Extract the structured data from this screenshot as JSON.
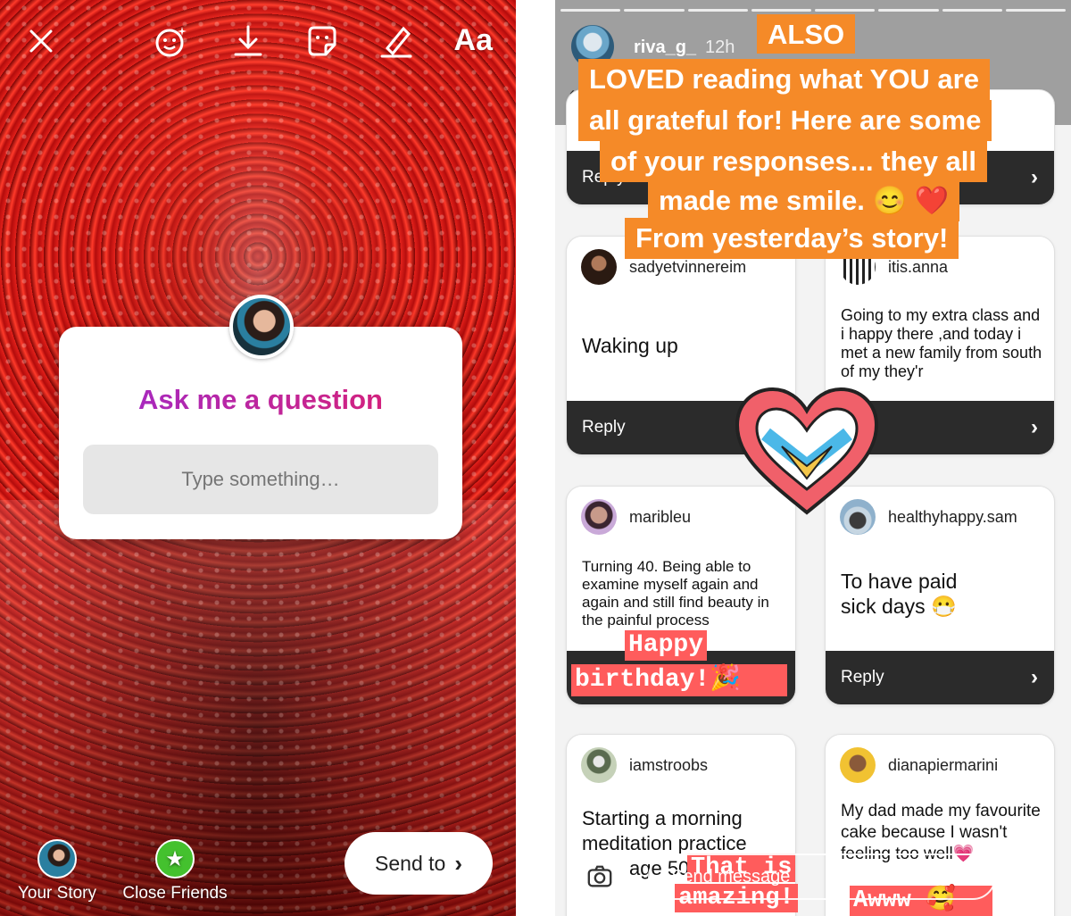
{
  "left": {
    "toolbar": {
      "close_icon": "close-icon",
      "face_effect_icon": "face-effects-icon",
      "download_icon": "download-icon",
      "sticker_icon": "sticker-icon",
      "draw_icon": "pen-icon",
      "text_label": "Aa"
    },
    "question_sticker": {
      "title": "Ask me a question",
      "placeholder": "Type something…"
    },
    "share": {
      "your_story": "Your Story",
      "close_friends": "Close Friends",
      "send_to": "Send to"
    }
  },
  "right": {
    "header": {
      "username": "riva_g_",
      "time": "12h"
    },
    "banner_lines": [
      "ALSO",
      "LOVED reading what YOU are",
      "all grateful for!  Here are some",
      "of your responses... they all",
      "made me smile. 😊 ❤️",
      "From yesterday’s story!"
    ],
    "reply_label": "Reply",
    "cards": [
      {
        "username": "sadyetvinnereim",
        "text": "Waking up"
      },
      {
        "username": "itis.anna",
        "text": "Going to my extra class and i  happy there ,and today i met a new family from south of my  they'r"
      },
      {
        "username": "maribleu",
        "text": "Turning 40. Being able to examine myself again and again and still find beauty in the painful process"
      },
      {
        "username": "healthyhappy.sam",
        "text": "To have paid sick days 😷"
      },
      {
        "username": "iamstroobs",
        "text": "Starting a morning meditation practice",
        "tail": "age 50"
      },
      {
        "username": "dianapiermarini",
        "text": "My dad made my favourite cake because I wasn't feeling too well💗"
      }
    ],
    "stickers": {
      "happy": "Happy",
      "birthday": "birthday!🎉",
      "that_is": "That is",
      "amazing": "amazing!",
      "awww": "Awww 🥰"
    },
    "footer": {
      "message_placeholder": "Send message"
    },
    "colors": {
      "banner": "#f58a28",
      "reply_bar": "#2b2b2b",
      "stamp": "#ff5c5c"
    }
  }
}
